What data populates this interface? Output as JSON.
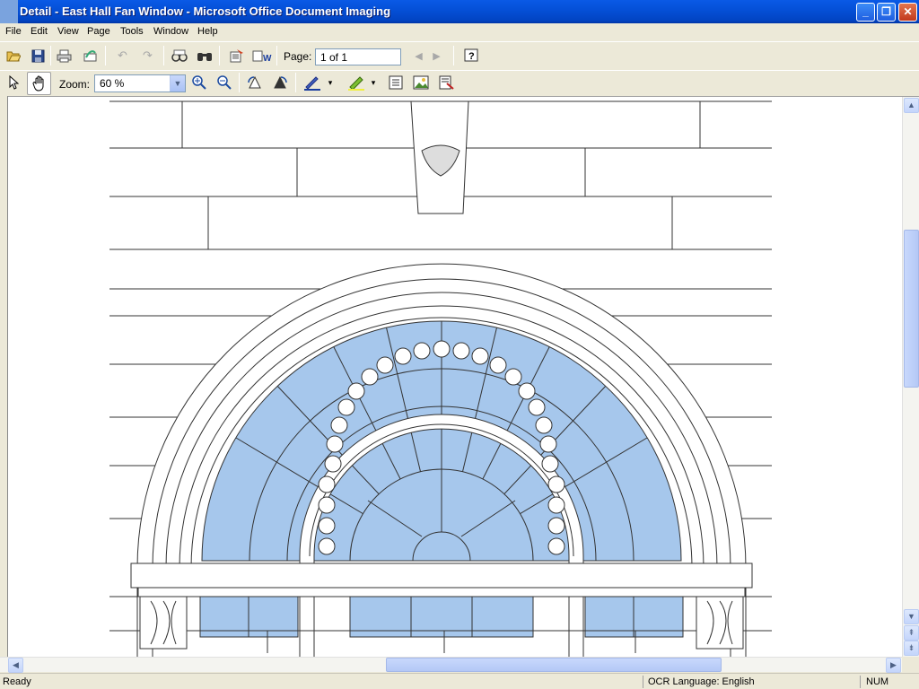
{
  "window": {
    "title": "Detail - East Hall Fan Window - Microsoft Office Document Imaging"
  },
  "caption_buttons": {
    "minimize": "_",
    "maximize": "❐",
    "close": "✕"
  },
  "menu": [
    "File",
    "Edit",
    "View",
    "Page",
    "Tools",
    "Window",
    "Help"
  ],
  "toolbar1": {
    "page_label": "Page:",
    "page_value": "1 of 1",
    "icons": [
      "open-icon",
      "save-icon",
      "print-icon",
      "send-icon",
      "undo-icon",
      "redo-icon",
      "reading-view-icon",
      "find-icon",
      "recognize-text-icon",
      "send-to-word-icon",
      "previous-page-icon",
      "next-page-icon",
      "help-icon"
    ]
  },
  "toolbar2": {
    "zoom_label": "Zoom:",
    "zoom_value": "60 %",
    "icons": [
      "select-pointer-icon",
      "hand-icon",
      "zoom-in-icon",
      "zoom-out-icon",
      "rotate-left-icon",
      "rotate-right-icon",
      "pen-icon",
      "highlighter-icon",
      "text-box-icon",
      "insert-picture-icon",
      "annotation-options-icon"
    ]
  },
  "document": {
    "image": "East Hall fan window architectural drawing",
    "glass_color": "#a6c7ec"
  },
  "status": {
    "left": "Ready",
    "ocr": "OCR Language: English",
    "num": "NUM"
  },
  "colors": {
    "titlebar": "#0244c2",
    "chrome": "#ece9d8",
    "glass": "#a6c7ec"
  }
}
